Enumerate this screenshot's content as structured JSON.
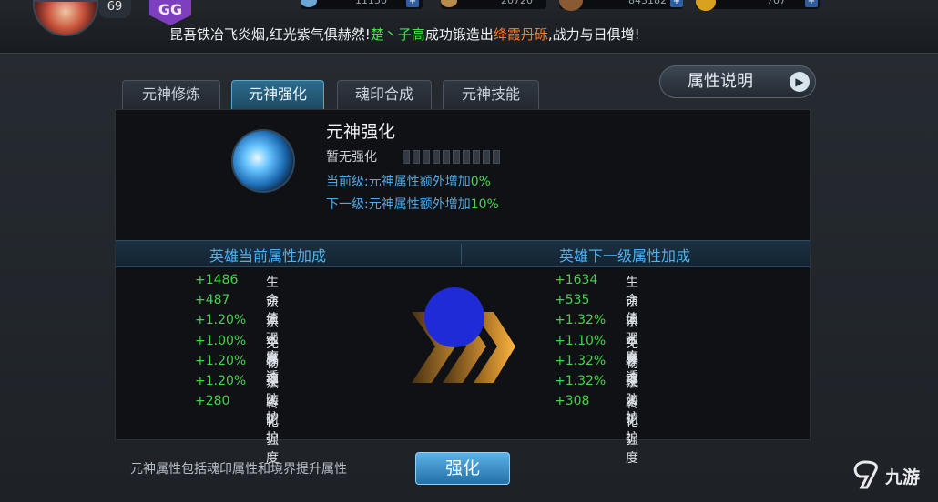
{
  "header": {
    "player_level": "69",
    "badge": "GG",
    "resources": [
      {
        "icon": "stamina-icon",
        "value": "11150"
      },
      {
        "icon": "gold-icon",
        "value": "20720"
      },
      {
        "icon": "coin-icon",
        "value": "843182"
      },
      {
        "icon": "ingot-icon",
        "value": "707"
      }
    ],
    "ticker": {
      "part1": "昆吾铁冶飞炎烟,红光紫气俱赫然!",
      "player": "楚丶子高",
      "part2": "成功锻造出",
      "item": "绛霞丹砾",
      "part3": ",战力与日俱增!"
    }
  },
  "tabs": [
    {
      "label": "元神修炼",
      "active": false
    },
    {
      "label": "元神强化",
      "active": true
    },
    {
      "label": "魂印合成",
      "active": false
    },
    {
      "label": "元神技能",
      "active": false
    }
  ],
  "attr_button": {
    "label": "属性说明"
  },
  "skill": {
    "title": "元神强化",
    "strength_status": "暂无强化",
    "pip_count": 10,
    "pips_filled": 0,
    "current_label": "当前级:元神属性额外增加",
    "current_pct": "0%",
    "next_label": "下一级:元神属性额外增加",
    "next_pct": "10%"
  },
  "columns": {
    "current_title": "英雄当前属性加成",
    "next_title": "英雄下一级属性加成"
  },
  "stats": [
    {
      "name": "生命值",
      "current": "+1486",
      "next": "+1634"
    },
    {
      "name": "法术强度",
      "current": "+487",
      "next": "+535"
    },
    {
      "name": "法术穿透",
      "current": "+1.20%",
      "next": "+1.32%"
    },
    {
      "name": "免暴率",
      "current": "+1.00%",
      "next": "+1.10%"
    },
    {
      "name": "物理防护",
      "current": "+1.20%",
      "next": "+1.32%"
    },
    {
      "name": "法术防护",
      "current": "+1.20%",
      "next": "+1.32%"
    },
    {
      "name": "转化强度",
      "current": "+280",
      "next": "+308"
    }
  ],
  "footer": {
    "note": "元神属性包括魂印属性和境界提升属性",
    "enhance_label": "强化"
  },
  "watermark": {
    "text": "九游"
  },
  "colors": {
    "accent": "#4eb2f2",
    "positive": "#46d24c",
    "highlight": "#ff7a1a"
  }
}
